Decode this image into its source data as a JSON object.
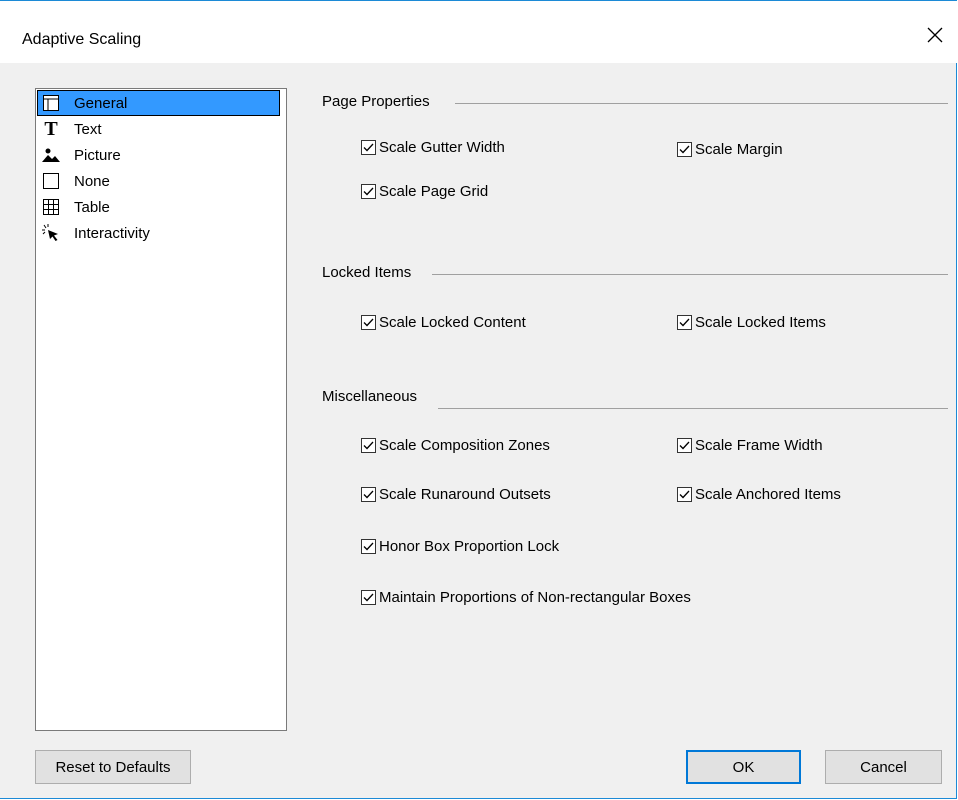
{
  "window": {
    "title": "Adaptive Scaling"
  },
  "sidebar": {
    "items": [
      {
        "label": "General",
        "icon": "layout-icon",
        "selected": true
      },
      {
        "label": "Text",
        "icon": "text-icon",
        "selected": false
      },
      {
        "label": "Picture",
        "icon": "picture-icon",
        "selected": false
      },
      {
        "label": "None",
        "icon": "empty-box-icon",
        "selected": false
      },
      {
        "label": "Table",
        "icon": "table-icon",
        "selected": false
      },
      {
        "label": "Interactivity",
        "icon": "cursor-click-icon",
        "selected": false
      }
    ]
  },
  "groups": {
    "page_properties": {
      "title": "Page Properties",
      "options": [
        {
          "label": "Scale Gutter Width",
          "checked": true
        },
        {
          "label": "Scale Margin",
          "checked": true
        },
        {
          "label": "Scale Page Grid",
          "checked": true
        }
      ]
    },
    "locked_items": {
      "title": "Locked Items",
      "options": [
        {
          "label": "Scale Locked Content",
          "checked": true
        },
        {
          "label": "Scale Locked Items",
          "checked": true
        }
      ]
    },
    "miscellaneous": {
      "title": "Miscellaneous",
      "options": [
        {
          "label": "Scale Composition Zones",
          "checked": true
        },
        {
          "label": "Scale Frame Width",
          "checked": true
        },
        {
          "label": "Scale Runaround Outsets",
          "checked": true
        },
        {
          "label": "Scale Anchored Items",
          "checked": true
        },
        {
          "label": "Honor Box Proportion Lock",
          "checked": true
        },
        {
          "label": "Maintain Proportions of Non-rectangular Boxes",
          "checked": true
        }
      ]
    }
  },
  "buttons": {
    "reset": "Reset to Defaults",
    "ok": "OK",
    "cancel": "Cancel"
  },
  "colors": {
    "accent": "#0078d7",
    "selection": "#3399ff",
    "dialog_bg": "#f0f0f0"
  }
}
